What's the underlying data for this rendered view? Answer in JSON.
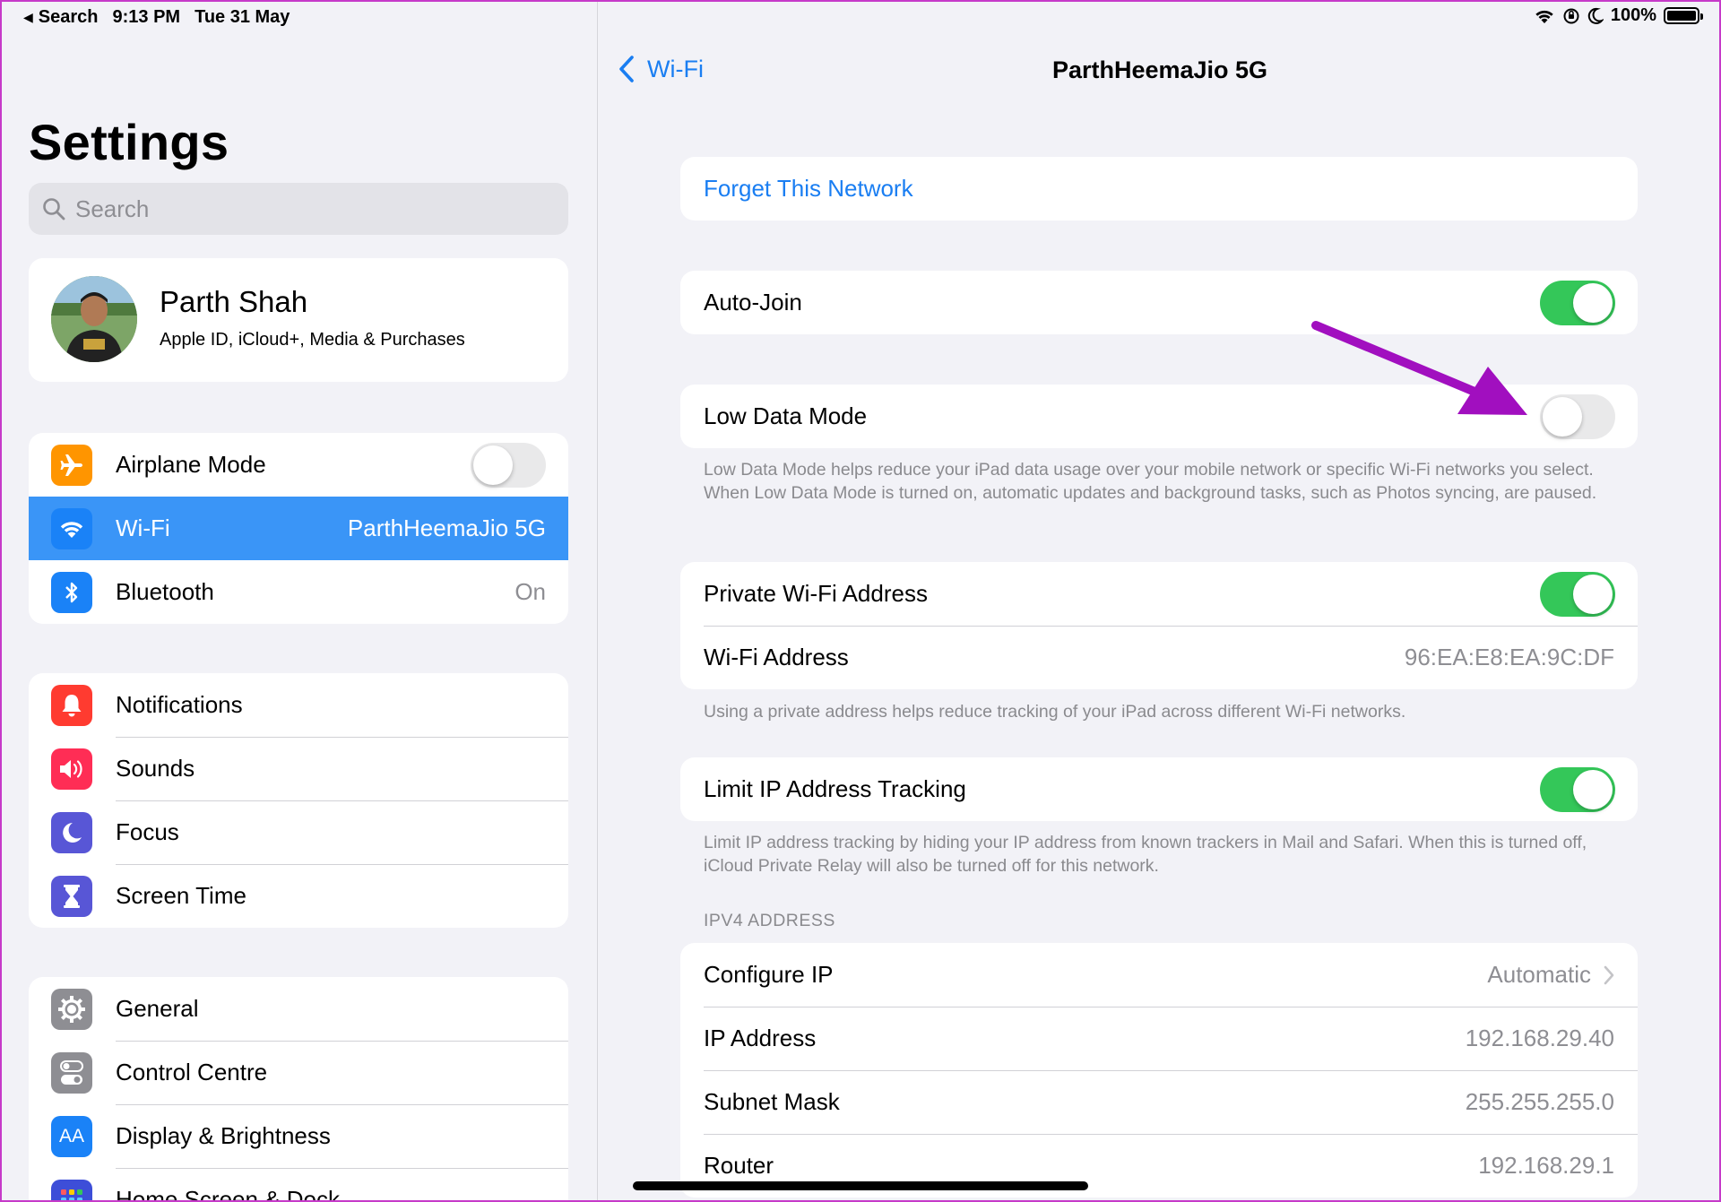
{
  "status_bar": {
    "back_label": "Search",
    "time": "9:13 PM",
    "date": "Tue 31 May",
    "battery": "100%"
  },
  "sidebar": {
    "title": "Settings",
    "search_placeholder": "Search",
    "profile": {
      "name": "Parth Shah",
      "subtitle": "Apple ID, iCloud+, Media & Purchases"
    },
    "group1": [
      {
        "label": "Airplane Mode",
        "icon": "airplane-icon",
        "toggle": false
      },
      {
        "label": "Wi-Fi",
        "icon": "wifi-icon",
        "value": "ParthHeemaJio 5G",
        "selected": true
      },
      {
        "label": "Bluetooth",
        "icon": "bluetooth-icon",
        "value": "On"
      }
    ],
    "group2": [
      {
        "label": "Notifications",
        "icon": "bell-icon"
      },
      {
        "label": "Sounds",
        "icon": "speaker-icon"
      },
      {
        "label": "Focus",
        "icon": "moon-icon"
      },
      {
        "label": "Screen Time",
        "icon": "hourglass-icon"
      }
    ],
    "group3": [
      {
        "label": "General",
        "icon": "gear-icon"
      },
      {
        "label": "Control Centre",
        "icon": "switches-icon"
      },
      {
        "label": "Display & Brightness",
        "icon": "text-size-icon",
        "glyph": "AA"
      },
      {
        "label": "Home Screen & Dock",
        "icon": "grid-icon"
      }
    ]
  },
  "detail": {
    "back_label": "Wi-Fi",
    "title": "ParthHeemaJio 5G",
    "forget": "Forget This Network",
    "auto_join": {
      "label": "Auto-Join",
      "on": true
    },
    "low_data": {
      "label": "Low Data Mode",
      "on": false,
      "footnote": "Low Data Mode helps reduce your iPad data usage over your mobile network or specific Wi-Fi networks you select. When Low Data Mode is turned on, automatic updates and background tasks, such as Photos syncing, are paused."
    },
    "private": {
      "label": "Private Wi-Fi Address",
      "on": true,
      "address_label": "Wi-Fi Address",
      "address_value": "96:EA:E8:EA:9C:DF",
      "footnote": "Using a private address helps reduce tracking of your iPad across different Wi-Fi networks."
    },
    "limit_ip": {
      "label": "Limit IP Address Tracking",
      "on": true,
      "footnote": "Limit IP address tracking by hiding your IP address from known trackers in Mail and Safari. When this is turned off, iCloud Private Relay will also be turned off for this network."
    },
    "ipv4": {
      "header": "IPV4 ADDRESS",
      "configure_label": "Configure IP",
      "configure_value": "Automatic",
      "ip_label": "IP Address",
      "ip_value": "192.168.29.40",
      "subnet_label": "Subnet Mask",
      "subnet_value": "255.255.255.0",
      "router_label": "Router",
      "router_value": "192.168.29.1"
    }
  },
  "colors": {
    "accent": "#1a7ef2",
    "selected_row": "#3a95f7",
    "toggle_on": "#34c759",
    "annotation_arrow": "#a10fbf"
  }
}
